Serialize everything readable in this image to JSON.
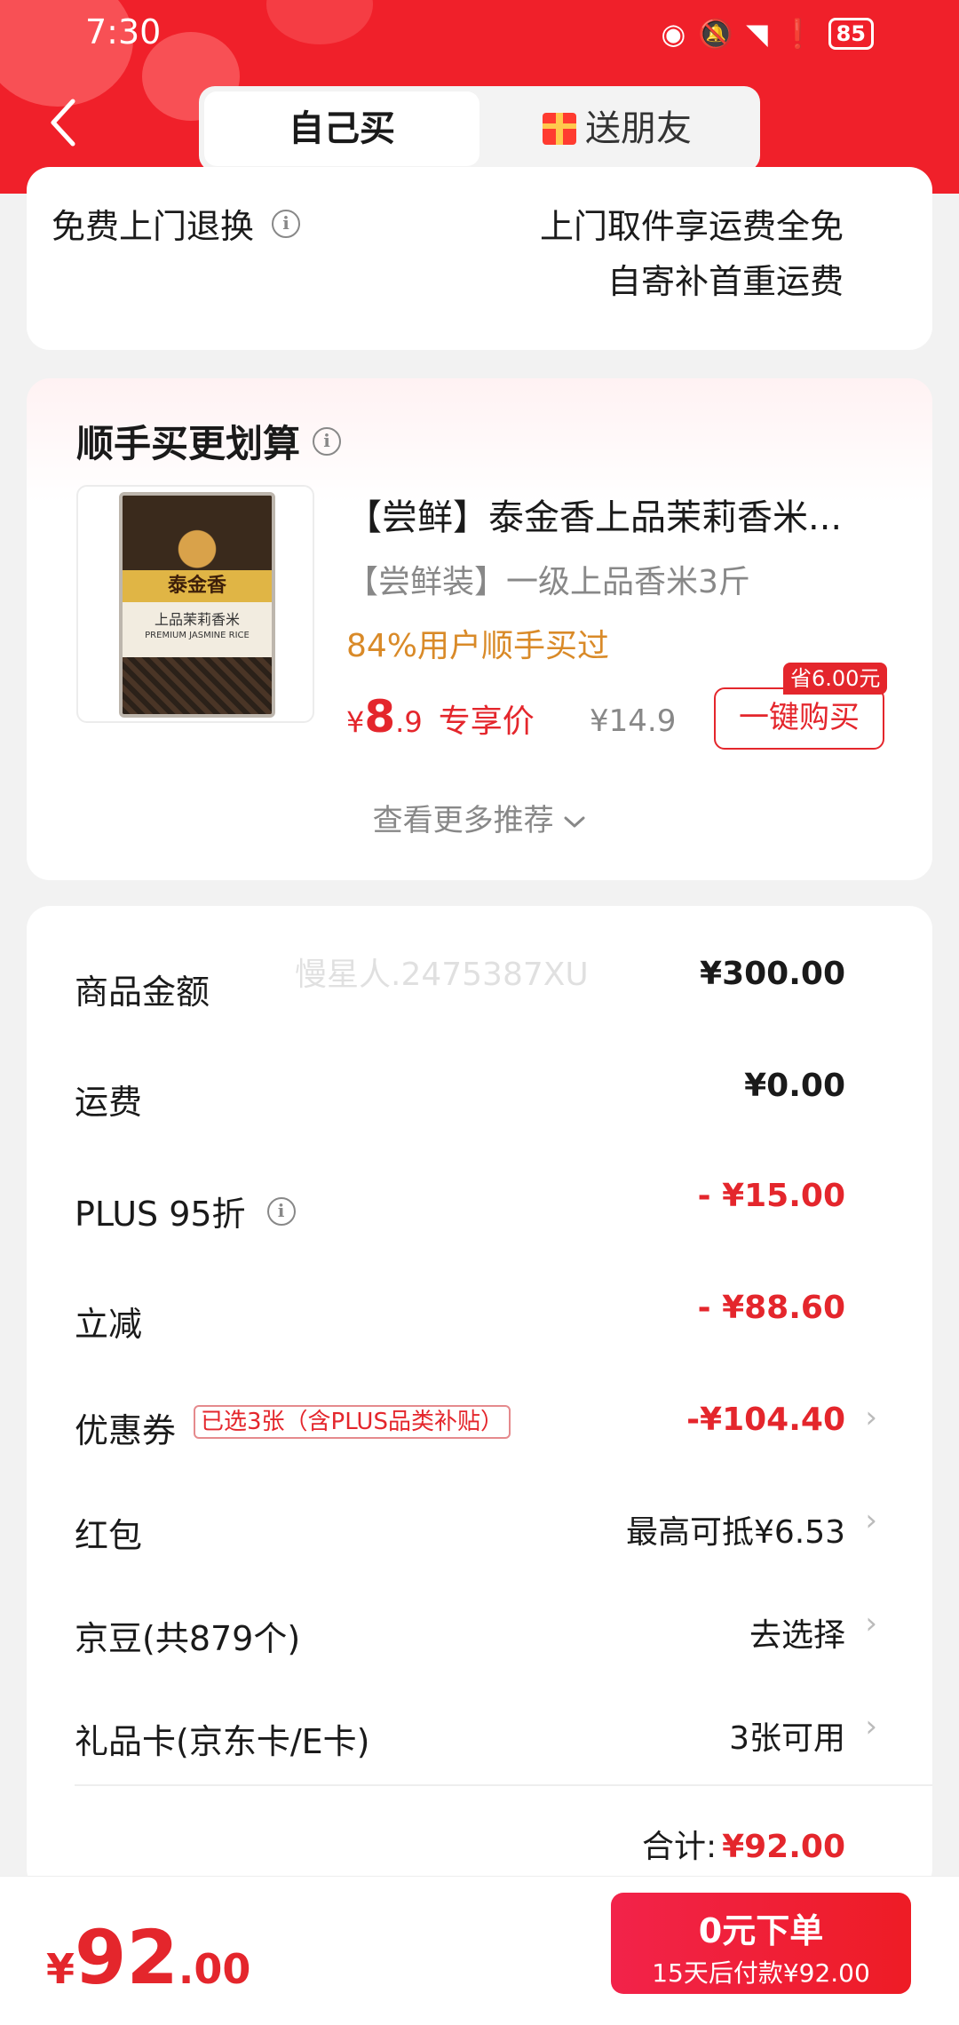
{
  "status_bar": {
    "time": "7:30",
    "battery": "85"
  },
  "header": {
    "tab_self": "自己买",
    "tab_gift": "送朋友"
  },
  "service": {
    "label": "免费上门退换",
    "line1": "上门取件享运费全免",
    "line2": "自寄补首重运费"
  },
  "recommend": {
    "title": "顺手买更划算",
    "product": {
      "title": "【尝鲜】泰金香上品茉莉香米...",
      "subtitle": "【尝鲜装】一级上品香米3斤",
      "hot": "84%用户顺手买过",
      "price_yen": "¥",
      "price_int": "8",
      "price_dec": ".9",
      "price_tag": "专享价",
      "orig_price": "¥14.9",
      "buy_label": "一键购买",
      "save_tag": "省6.00元",
      "bag_brand": "泰金香",
      "bag_name": "上品茉莉香米",
      "bag_en": "PREMIUM JASMINE RICE"
    },
    "more": "查看更多推荐"
  },
  "summary": {
    "watermark": "慢星人.2475387XU",
    "rows": [
      {
        "label": "商品金额",
        "value": "¥300.00"
      },
      {
        "label": "运费",
        "value": "¥0.00"
      },
      {
        "label": "PLUS 95折",
        "value": "- ¥15.00"
      },
      {
        "label": "立减",
        "value": "- ¥88.60"
      },
      {
        "label": "优惠券",
        "tag": "已选3张（含PLUS品类补贴）",
        "value": "-¥104.40"
      },
      {
        "label": "红包",
        "value": "最高可抵¥6.53"
      },
      {
        "label": "京豆(共879个)",
        "value": "去选择"
      },
      {
        "label": "礼品卡(京东卡/E卡)",
        "value": "3张可用"
      }
    ],
    "total_label": "合计:",
    "total_value": "¥92.00"
  },
  "bottom": {
    "yen": "¥",
    "int": "92",
    "dec": ".00",
    "order_main": "0元下单",
    "order_sub": "15天后付款¥92.00"
  },
  "colors": {
    "brand_red": "#f0202a",
    "price_red": "#e4262c",
    "hot_orange": "#d98a28"
  }
}
